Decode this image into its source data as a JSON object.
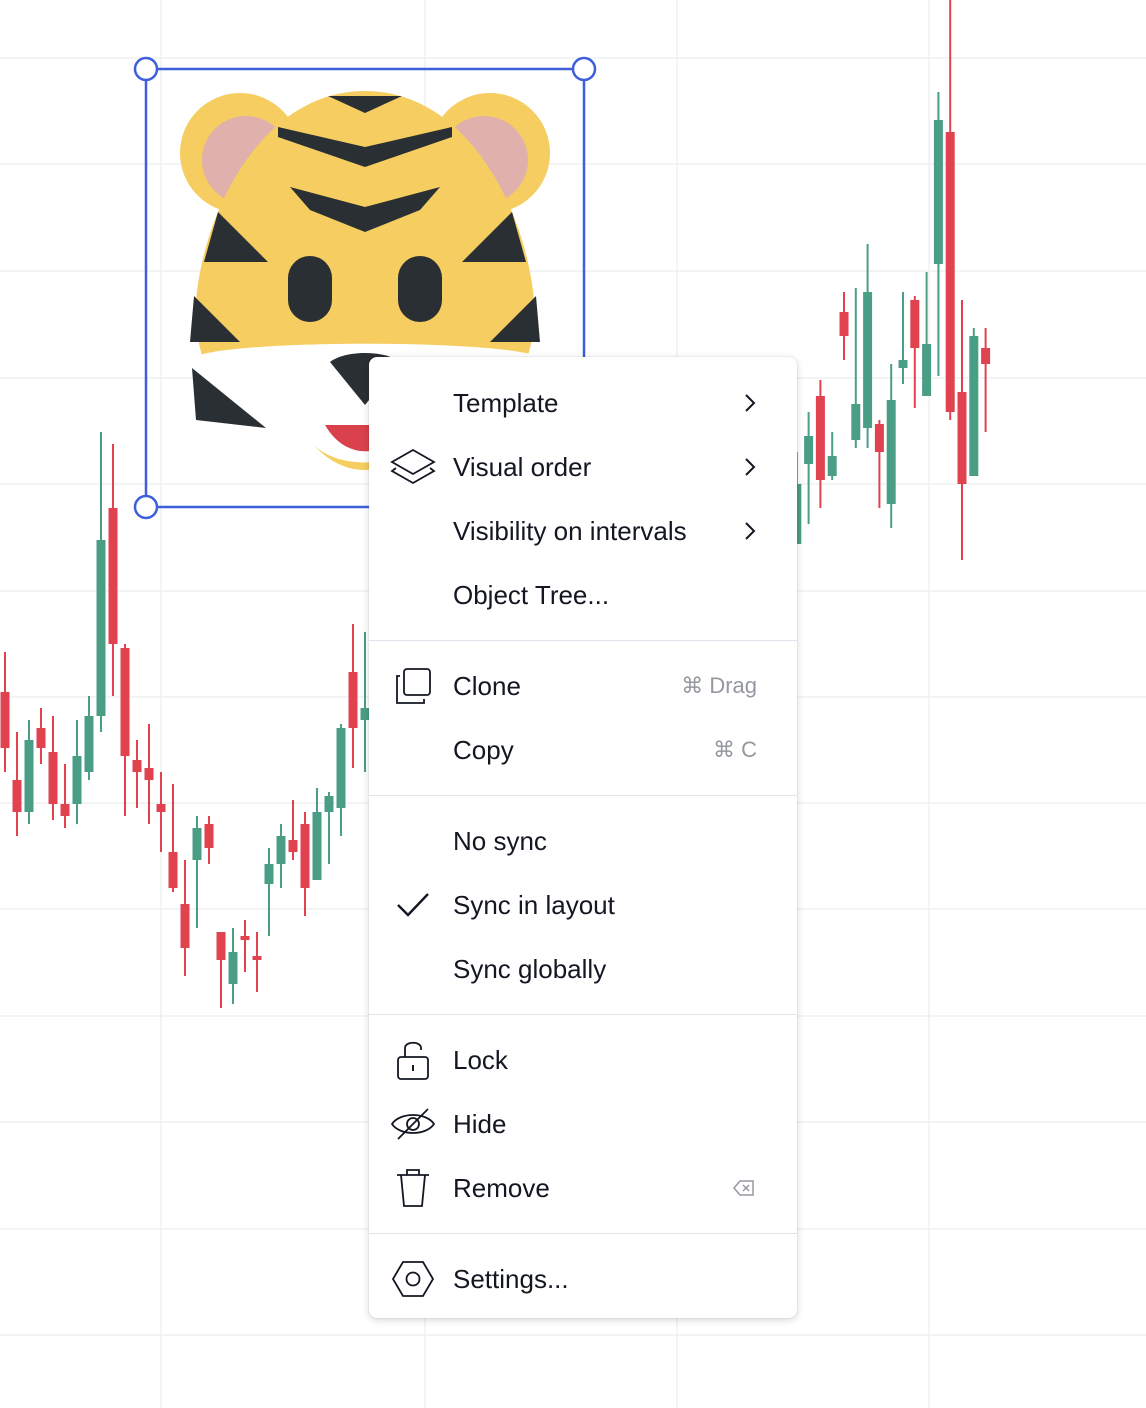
{
  "sticker": {
    "icon": "tiger-face-emoji",
    "selection_color": "#2962ff"
  },
  "candles_left": [
    [
      4.0,
      2.6,
      5.0,
      2.0
    ],
    [
      1.8,
      1.0,
      3.0,
      0.4
    ],
    [
      1.0,
      2.8,
      3.3,
      0.7
    ],
    [
      3.1,
      2.6,
      3.6,
      2.2
    ],
    [
      2.5,
      1.2,
      3.4,
      0.8
    ],
    [
      1.2,
      0.9,
      2.2,
      0.6
    ],
    [
      1.2,
      2.4,
      3.3,
      0.7
    ],
    [
      2.0,
      3.4,
      3.9,
      1.8
    ],
    [
      3.4,
      7.8,
      10.5,
      3.0
    ],
    [
      8.6,
      5.2,
      10.2,
      3.9
    ],
    [
      5.1,
      2.4,
      5.2,
      0.9
    ],
    [
      2.3,
      2.0,
      2.8,
      1.1
    ],
    [
      2.1,
      1.8,
      3.2,
      0.7
    ],
    [
      1.2,
      1.0,
      2.0,
      0.0
    ],
    [
      0.0,
      -0.9,
      1.7,
      -1.0
    ],
    [
      -1.3,
      -2.4,
      -0.2,
      -3.1
    ],
    [
      -0.2,
      0.6,
      0.9,
      -1.9
    ],
    [
      0.7,
      0.1,
      0.9,
      -0.3
    ],
    [
      -2.0,
      -2.7,
      -2.0,
      -3.9
    ],
    [
      -3.3,
      -2.5,
      -1.9,
      -3.8
    ],
    [
      -2.1,
      -2.2,
      -1.7,
      -3.0
    ],
    [
      -2.6,
      -2.7,
      -2.0,
      -3.5
    ],
    [
      -0.8,
      -0.3,
      0.1,
      -2.1
    ],
    [
      -0.3,
      0.4,
      0.7,
      -0.9
    ],
    [
      0.3,
      -0.0,
      1.3,
      -0.2
    ],
    [
      0.7,
      -0.9,
      1.0,
      -1.6
    ],
    [
      -0.7,
      1.0,
      1.6,
      -0.7
    ],
    [
      1.0,
      1.4,
      1.5,
      -0.3
    ],
    [
      1.1,
      3.1,
      3.2,
      0.4
    ],
    [
      4.5,
      3.1,
      5.7,
      2.1
    ],
    [
      3.3,
      3.6,
      5.5,
      2.0
    ],
    [
      3.4,
      3.6,
      4.4,
      2.2
    ],
    [
      -0.9,
      -2.1,
      -0.4,
      -2.6
    ],
    [
      -0.8,
      1.0,
      2.0,
      -0.9
    ]
  ],
  "candles_right": [
    [
      11.0,
      8.1,
      11.0,
      7.7
    ],
    [
      7.7,
      9.2,
      10.0,
      7.7
    ],
    [
      9.7,
      10.4,
      11.0,
      8.2
    ],
    [
      11.4,
      9.3,
      11.8,
      8.6
    ],
    [
      9.4,
      9.9,
      10.5,
      9.3
    ],
    [
      13.5,
      12.9,
      14.0,
      12.3
    ],
    [
      10.3,
      11.2,
      14.1,
      10.1
    ],
    [
      10.6,
      14.0,
      15.2,
      10.1
    ],
    [
      10.7,
      10.0,
      10.8,
      8.6
    ],
    [
      8.7,
      11.3,
      12.2,
      8.1
    ],
    [
      12.1,
      12.3,
      14.0,
      11.7
    ],
    [
      13.8,
      12.6,
      13.9,
      11.1
    ],
    [
      11.4,
      12.7,
      14.5,
      11.4
    ],
    [
      14.7,
      18.3,
      19.0,
      11.9
    ],
    [
      18.0,
      11.0,
      22.0,
      10.8
    ],
    [
      11.5,
      9.2,
      13.8,
      7.3
    ],
    [
      9.4,
      12.9,
      13.1,
      11.2
    ],
    [
      12.6,
      12.2,
      13.1,
      10.5
    ]
  ],
  "colors": {
    "up": "#4b9e86",
    "down": "#e0434f",
    "grid": "#eef0f3",
    "text": "#131722",
    "muted": "#9598a1"
  },
  "menu": {
    "template": "Template",
    "visual_order": "Visual order",
    "visibility": "Visibility on intervals",
    "object_tree": "Object Tree...",
    "clone": "Clone",
    "clone_shortcut": "⌘ Drag",
    "copy": "Copy",
    "copy_shortcut": "⌘ C",
    "no_sync": "No sync",
    "sync_layout": "Sync in layout",
    "sync_global": "Sync globally",
    "lock": "Lock",
    "hide": "Hide",
    "remove": "Remove",
    "settings": "Settings..."
  }
}
